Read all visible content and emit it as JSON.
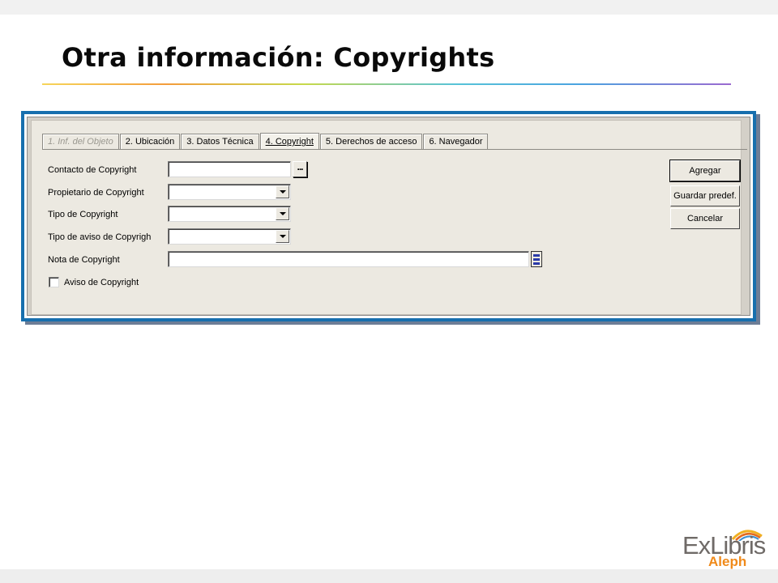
{
  "slide": {
    "title": "Otra información: Copyrights"
  },
  "tabs": [
    {
      "label": "1. Inf. del Objeto",
      "state": "disabled"
    },
    {
      "label": "2. Ubicación",
      "state": "normal"
    },
    {
      "label": "3. Datos Técnica",
      "state": "normal"
    },
    {
      "label": "4. Copyright",
      "state": "active"
    },
    {
      "label": "5. Derechos de acceso",
      "state": "normal"
    },
    {
      "label": "6. Navegador",
      "state": "normal"
    }
  ],
  "form": {
    "contact_label": "Contacto de Copyright",
    "contact_value": "",
    "browse_label": "...",
    "owner_label": "Propietario de Copyright",
    "owner_value": "",
    "type_label": "Tipo de Copyright",
    "type_value": "",
    "notice_type_label": "Tipo de aviso de Copyrigh",
    "notice_type_value": "",
    "note_label": "Nota de Copyright",
    "note_value": "",
    "notice_checkbox_label": "Aviso de Copyright",
    "notice_checkbox_checked": false
  },
  "buttons": {
    "add": "Agregar",
    "save_default": "Guardar predef.",
    "cancel": "Cancelar"
  },
  "logo": {
    "brand": "ExLibris",
    "product": "Aleph"
  },
  "colors": {
    "frame_border": "#176fae",
    "logo_accent": "#f08a1a"
  }
}
